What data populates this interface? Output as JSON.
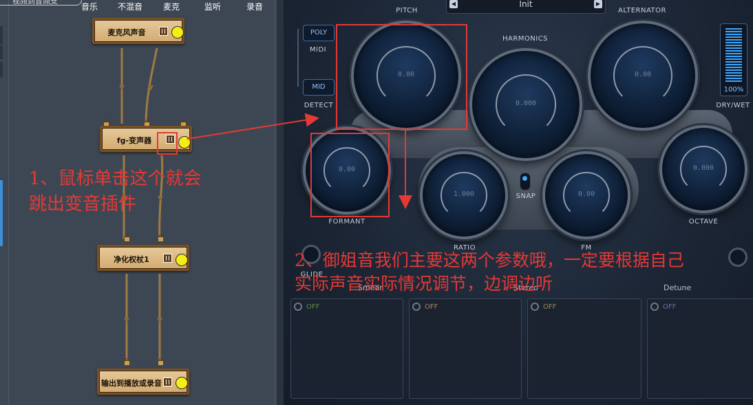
{
  "toolbar": {
    "top_fragment": "视频到音频支",
    "tabs": [
      "音乐",
      "不混音",
      "麦克",
      "监听",
      "录音"
    ]
  },
  "graph": {
    "nodes": [
      {
        "label": "麦克风声音"
      },
      {
        "label": "fg-变声器"
      },
      {
        "label": "净化权杖1"
      },
      {
        "label": "输出到播放或录音"
      }
    ]
  },
  "plugin": {
    "preset": {
      "name": "Init",
      "prev_icon": "triangle-left-icon",
      "next_icon": "triangle-right-icon"
    },
    "labels": {
      "pitch": "PITCH",
      "alternator": "ALTERNATOR",
      "harmonics": "HARMONICS",
      "midi": "MIDI",
      "detect": "DETECT",
      "formant": "FORMANT",
      "snap": "SNAP",
      "ratio": "RATIO",
      "fm": "FM",
      "octave": "OCTAVE",
      "dry_wet": "DRY/WET",
      "glide": "GLIDE"
    },
    "buttons": {
      "poly": "POLY",
      "mid": "MID"
    },
    "knobs": {
      "pitch": "0.00",
      "harmonics": "0.000",
      "alternator": "0.00",
      "formant": "0.00",
      "ratio": "1.000",
      "fm": "0.00",
      "octave": "0.000"
    },
    "dry_wet_value": "100%",
    "fx_sections": [
      {
        "label": "Smear",
        "state": "OFF"
      },
      {
        "label": "Stereo",
        "state": "OFF"
      },
      {
        "label": "",
        "state": "OFF"
      },
      {
        "label": "Detune",
        "state": "OFF"
      }
    ],
    "accent": "#3fa9ff"
  },
  "annotations": {
    "note1_line1": "1、鼠标单击这个就会",
    "note1_line2": "跳出变音插件",
    "note2_line1": "2、御姐音我们主要这两个参数哦，一定要根据自己",
    "note2_line2": "实际声音实际情况调节，边调边听",
    "color": "#e53935"
  }
}
